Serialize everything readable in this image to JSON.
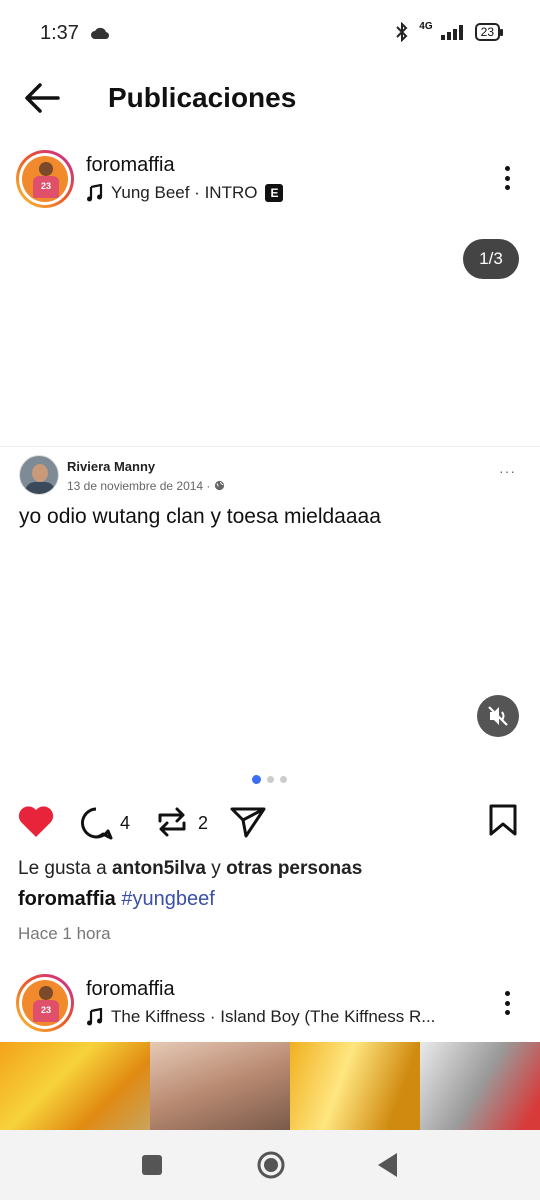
{
  "status_bar": {
    "time": "1:37",
    "network": "4G",
    "battery": "23"
  },
  "header": {
    "title": "Publicaciones"
  },
  "post1": {
    "username": "foromaffia",
    "song": "Yung Beef · INTRO",
    "explicit_badge": "E",
    "counter": "1/3",
    "embedded": {
      "name": "Riviera Manny",
      "date": "13 de noviembre de 2014 ·",
      "more": "···",
      "text": "yo odio wutang clan y toesa mieldaaaa"
    },
    "comments_count": "4",
    "reposts_count": "2",
    "likes_prefix": "Le gusta a ",
    "likes_user": "anton5ilva",
    "likes_mid": " y ",
    "likes_others": "otras personas",
    "caption_user": "foromaffia",
    "caption_tag": "#yungbeef",
    "time_ago": "Hace 1 hora"
  },
  "post2": {
    "username": "foromaffia",
    "song": "The Kiffness · Island Boy (The Kiffness R..."
  },
  "colors": {
    "like": "#e8243a",
    "hashtag": "#3a4fa8",
    "dot_active": "#3b6ff0"
  }
}
